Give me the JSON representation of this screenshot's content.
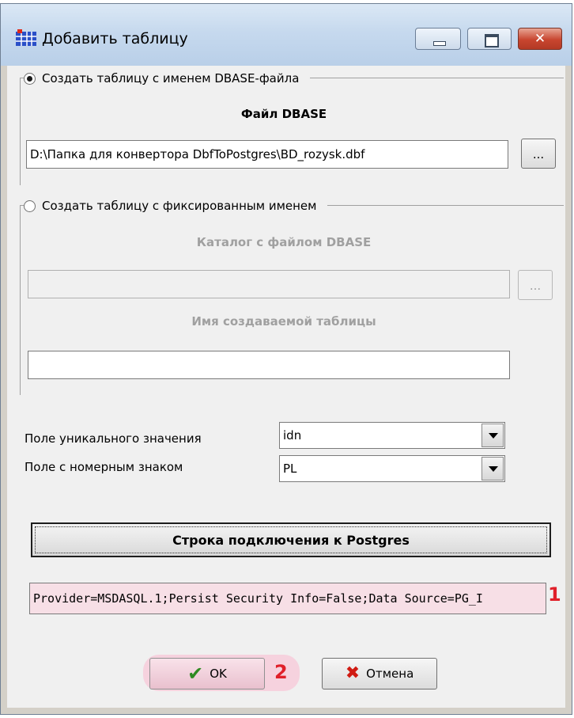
{
  "window": {
    "title": "Добавить таблицу",
    "close_glyph": "✕"
  },
  "group1": {
    "option_label": "Создать таблицу с именем DBASE-файла",
    "selected": true,
    "file_label": "Файл DBASE",
    "file_value": "D:\\Папка для конвертора DbfToPostgres\\BD_rozysk.dbf",
    "browse_label": "..."
  },
  "group2": {
    "option_label": "Создать таблицу с фиксированным именем",
    "selected": false,
    "catalog_label": "Каталог с файлом DBASE",
    "catalog_value": "",
    "browse_label": "...",
    "table_name_label": "Имя создаваемой таблицы",
    "table_name_value": ""
  },
  "unique_field": {
    "label": "Поле уникального значения",
    "value": "idn"
  },
  "plate_field": {
    "label": "Поле с номерным знаком",
    "value": "PL"
  },
  "connection": {
    "button_label": "Строка подключения к Postgres",
    "value": "Provider=MSDASQL.1;Persist Security Info=False;Data Source=PG_I",
    "marker": "1"
  },
  "footer": {
    "ok_label": "OK",
    "ok_marker": "2",
    "cancel_label": "Отмена"
  },
  "icons": {
    "title": "table-grid-icon",
    "ok": "check-icon",
    "cancel": "x-icon"
  },
  "colors": {
    "highlight": "#f6d2de",
    "marker": "#e0202a"
  }
}
